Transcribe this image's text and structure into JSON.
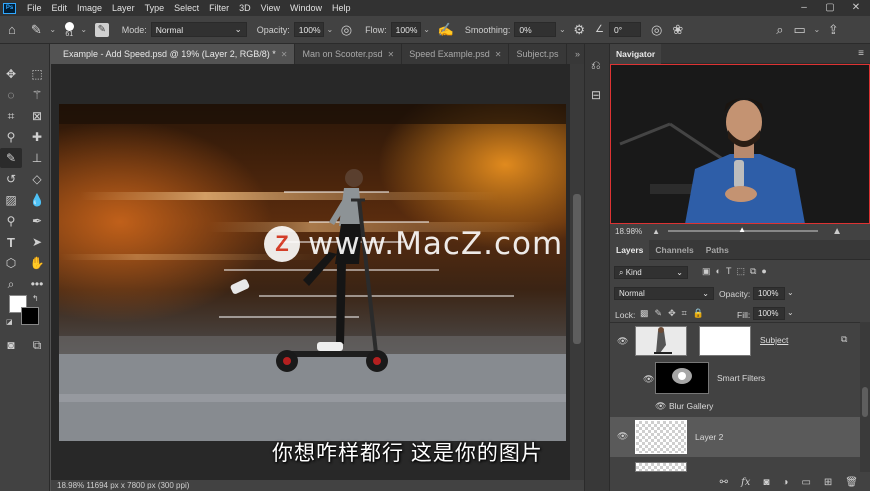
{
  "menu": {
    "logo": "Ps",
    "items": [
      "File",
      "Edit",
      "Image",
      "Layer",
      "Type",
      "Select",
      "Filter",
      "3D",
      "View",
      "Window",
      "Help"
    ]
  },
  "options_bar": {
    "brush_size": "61",
    "mode_label": "Mode:",
    "mode_value": "Normal",
    "opacity_label": "Opacity:",
    "opacity_value": "100%",
    "flow_label": "Flow:",
    "flow_value": "100%",
    "smoothing_label": "Smoothing:",
    "smoothing_value": "0%",
    "angle_value": "0°"
  },
  "tabs": [
    {
      "label": "Example - Add Speed.psd @ 19% (Layer 2, RGB/8) *",
      "active": true
    },
    {
      "label": "Man on Scooter.psd",
      "active": false
    },
    {
      "label": "Speed Example.psd",
      "active": false
    },
    {
      "label": "Subject.ps",
      "active": false
    }
  ],
  "tabs_overflow": "»",
  "status": "18.98%   11694 px x 7800 px (300 ppi)",
  "navigator": {
    "title": "Navigator",
    "zoom": "18.98%"
  },
  "layers_panel": {
    "tabs": [
      "Layers",
      "Channels",
      "Paths"
    ],
    "filter_kind": "Kind",
    "blend_mode": "Normal",
    "opacity_label": "Opacity:",
    "opacity_value": "100%",
    "lock_label": "Lock:",
    "fill_label": "Fill:",
    "fill_value": "100%",
    "layers": {
      "subject": "Subject",
      "smart_filters": "Smart Filters",
      "blur_gallery": "Blur Gallery",
      "layer2": "Layer 2"
    },
    "footer_icons": [
      "link-icon",
      "fx-icon",
      "mask-icon",
      "adjustment-icon",
      "group-icon",
      "new-layer-icon",
      "trash-icon"
    ]
  },
  "overlay": {
    "subtitle": "你想咋样都行 这是你的图片",
    "watermark_logo": "Z",
    "watermark_text": "www.MacZ.com"
  }
}
